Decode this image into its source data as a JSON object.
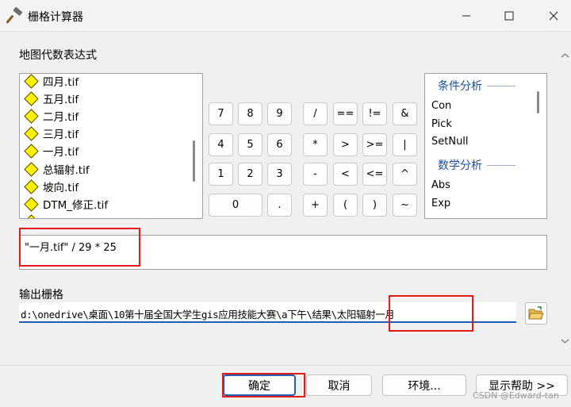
{
  "window": {
    "title": "栅格计算器",
    "icon": "hammer-icon",
    "controls": [
      "minimize-icon",
      "maximize-icon",
      "close-icon"
    ]
  },
  "expression_label": "地图代数表达式",
  "layers": [
    "四月.tif",
    "五月.tif",
    "二月.tif",
    "三月.tif",
    "一月.tif",
    "总辐射.tif",
    "坡向.tif",
    "DTM_修正.tif"
  ],
  "calculator": {
    "rows": [
      [
        "7",
        "8",
        "9",
        "/",
        "==",
        "!=",
        "&"
      ],
      [
        "4",
        "5",
        "6",
        "*",
        ">",
        ">=",
        "|"
      ],
      [
        "1",
        "2",
        "3",
        "-",
        "<",
        "<=",
        "^"
      ],
      [
        "0",
        ".",
        "+",
        "(",
        ")",
        "~"
      ]
    ]
  },
  "functions": {
    "groups": [
      {
        "header": "条件分析",
        "items": [
          "Con",
          "Pick",
          "SetNull"
        ]
      },
      {
        "header": "数学分析",
        "items": [
          "Abs",
          "Exp"
        ]
      }
    ]
  },
  "expression": "\"一月.tif\" / 29 * 25",
  "output_label": "输出栅格",
  "output_path": "d:\\onedrive\\桌面\\10第十届全国大学生gis应用技能大赛\\a下午\\结果\\太阳辐射一月",
  "buttons": {
    "ok": "确定",
    "cancel": "取消",
    "environments": "环境...",
    "help": "显示帮助 >>"
  },
  "watermark": "CSDN @Edward-tan",
  "colors": {
    "accent": "#1f5fb5",
    "group_header": "#1a4fa0",
    "highlight_box": "#e01b1b",
    "layer_icon": "#fff200"
  }
}
